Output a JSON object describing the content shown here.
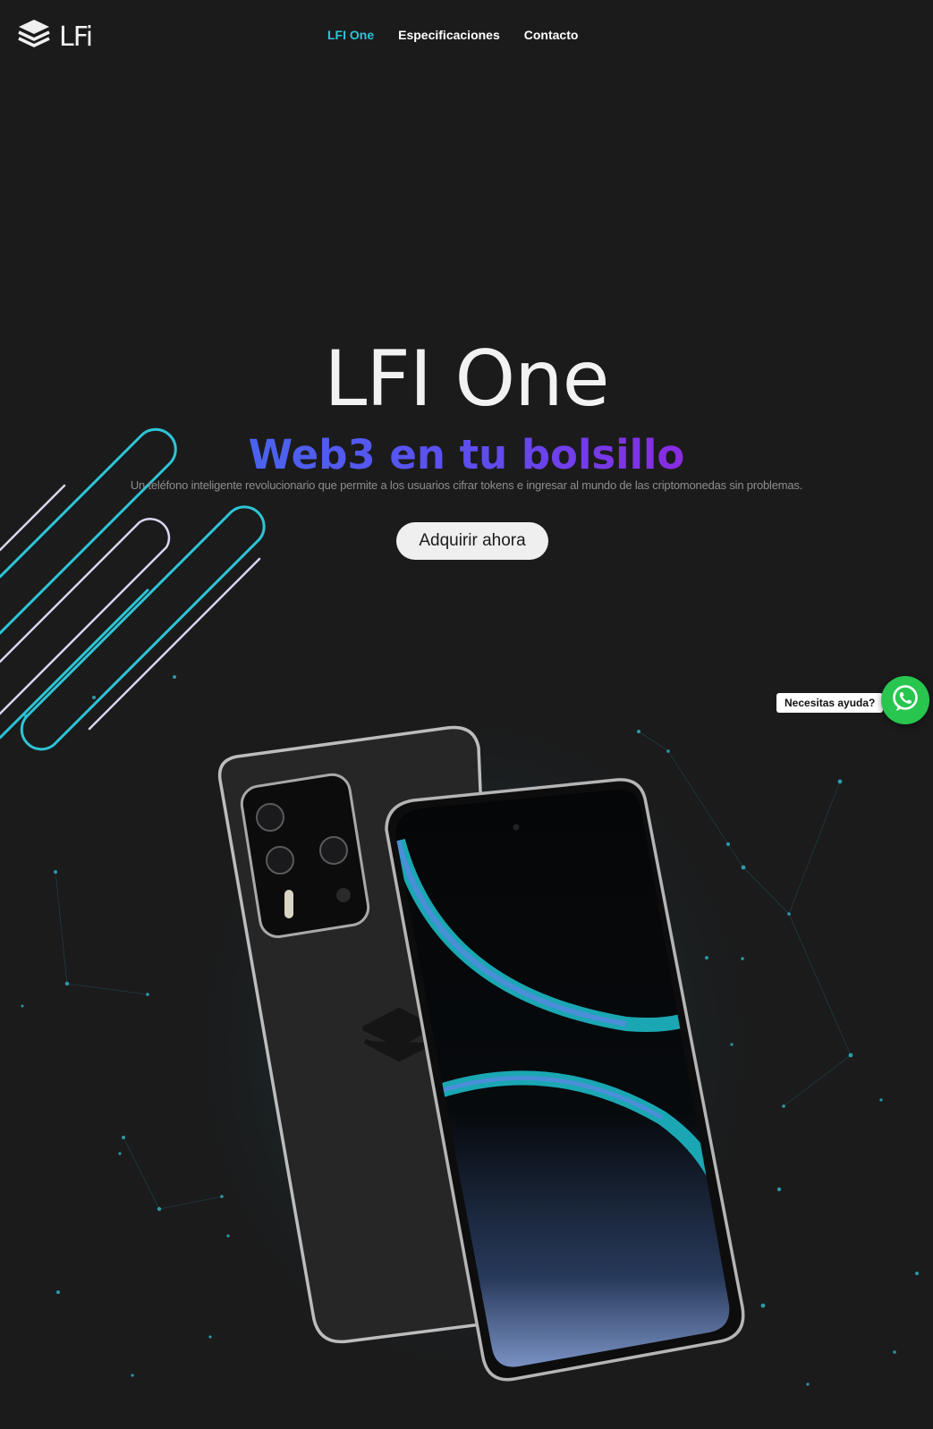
{
  "header": {
    "logo_text": "LFi",
    "nav": [
      {
        "label": "LFI One",
        "active": true
      },
      {
        "label": "Especificaciones",
        "active": false
      },
      {
        "label": "Contacto",
        "active": false
      }
    ]
  },
  "hero": {
    "title": "LFI One",
    "subtitle": "Web3 en tu bolsillo",
    "description": "Un teléfono inteligente revolucionario que permite a los usuarios cifrar tokens e ingresar al mundo de las criptomonedas sin problemas.",
    "cta_label": "Adquirir ahora"
  },
  "help_widget": {
    "label": "Necesitas ayuda?",
    "icon": "whatsapp-icon",
    "color": "#28c64f"
  },
  "colors": {
    "background": "#1b1b1c",
    "accent": "#2ec4d6",
    "subtitle_gradient_start": "#4a63ee",
    "subtitle_gradient_end": "#8a2be2"
  }
}
